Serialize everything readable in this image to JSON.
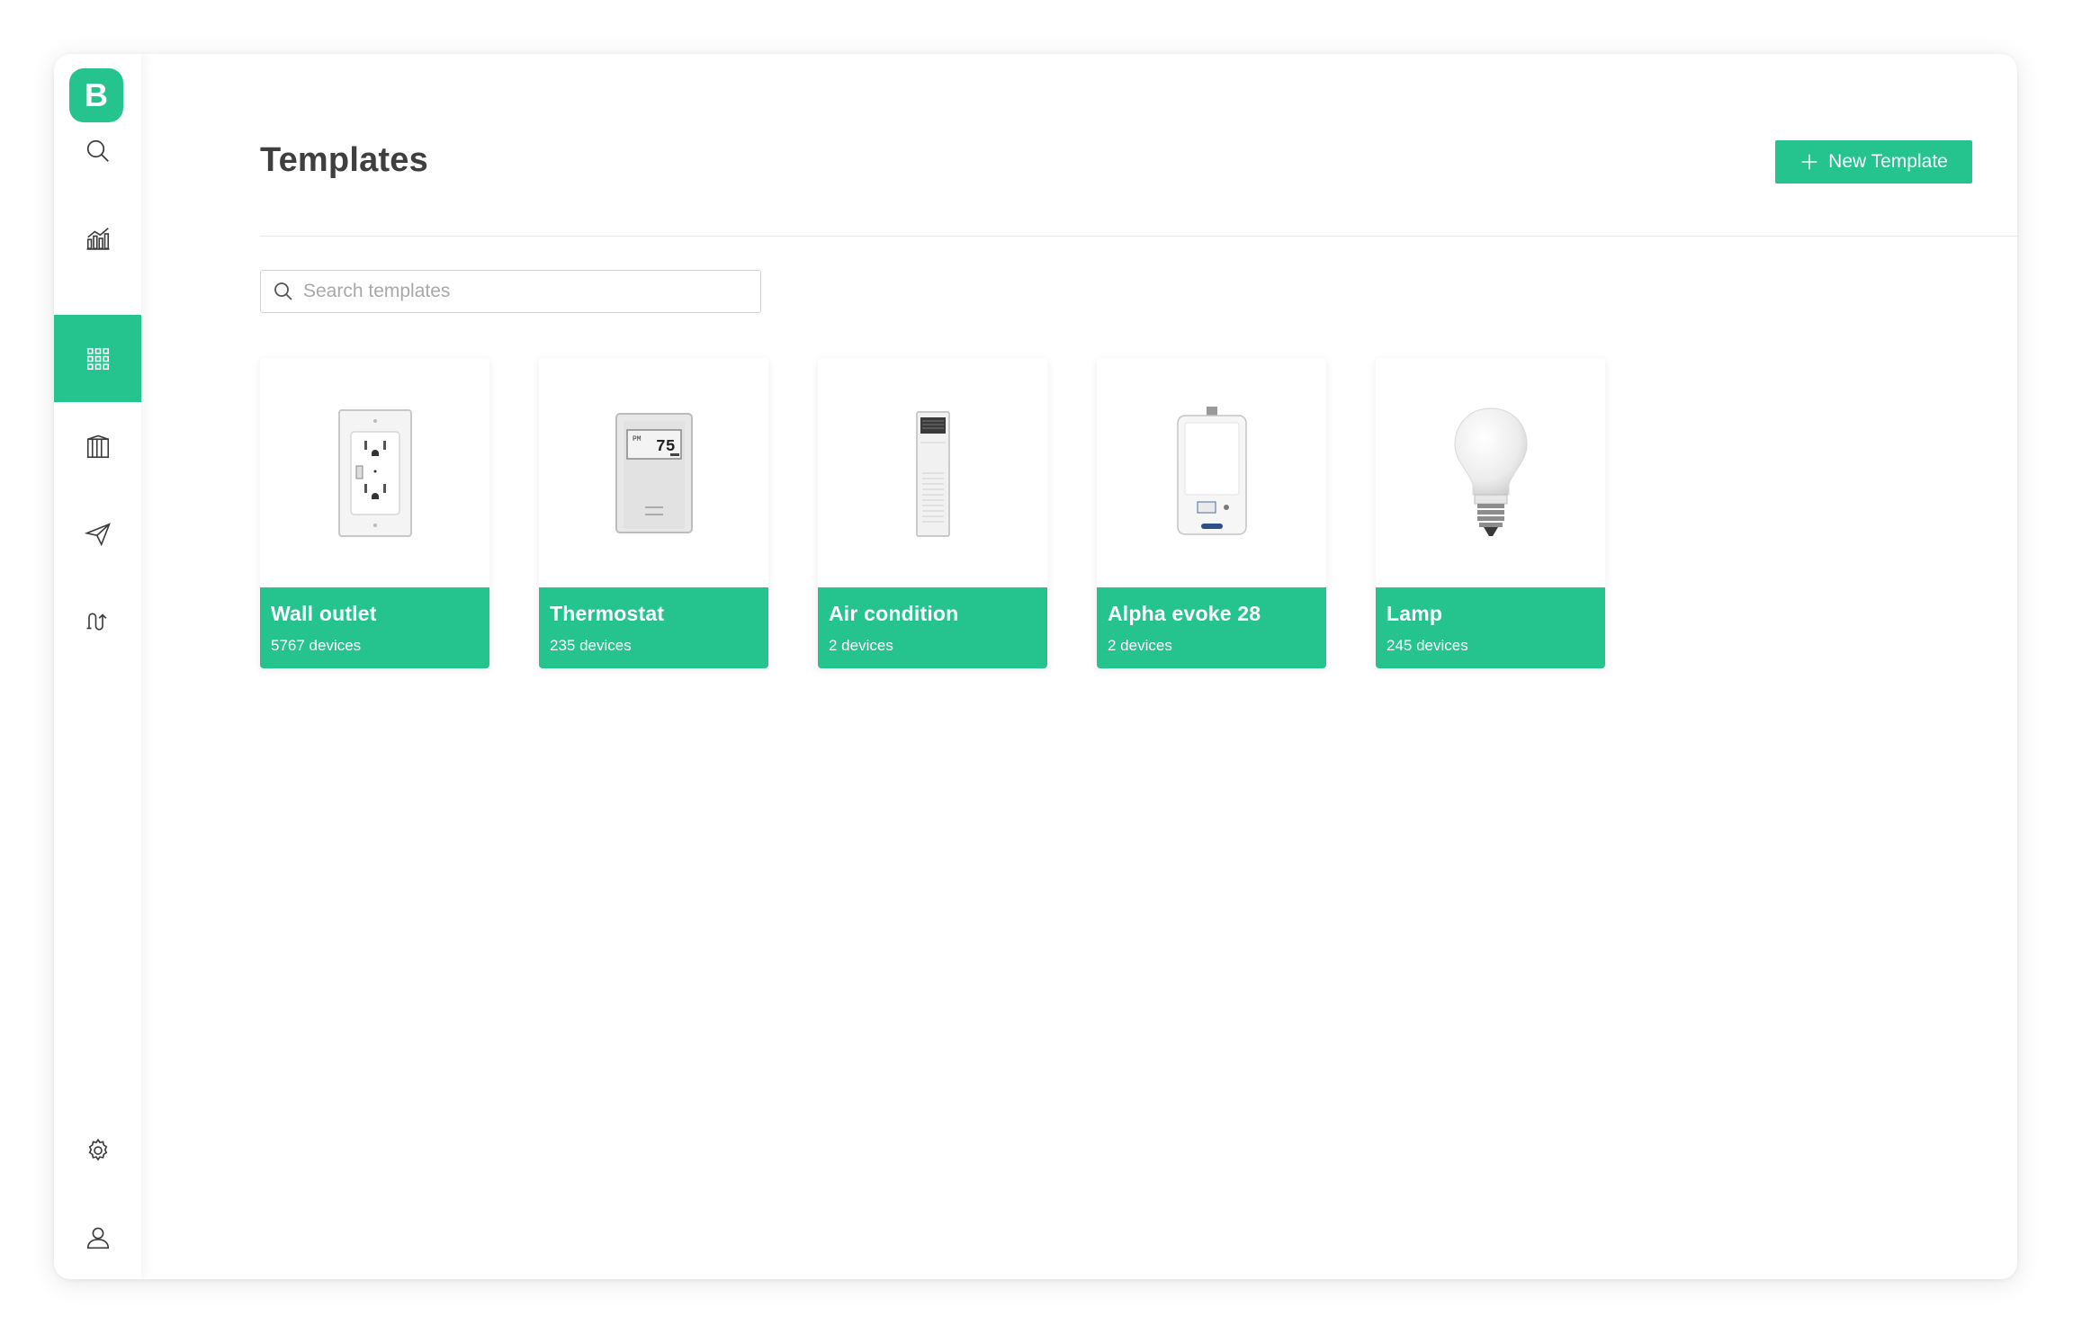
{
  "app": {
    "logo_letter": "B"
  },
  "sidebar": {
    "items": [
      {
        "icon": "search-icon"
      },
      {
        "icon": "analytics-icon"
      },
      {
        "icon": "templates-grid-icon",
        "active": true
      },
      {
        "icon": "building-icon"
      },
      {
        "icon": "send-icon"
      },
      {
        "icon": "flow-icon"
      },
      {
        "icon": "settings-gear-icon"
      },
      {
        "icon": "user-icon"
      }
    ]
  },
  "header": {
    "title": "Templates",
    "new_button_label": "New Template"
  },
  "search": {
    "placeholder": "Search templates",
    "value": ""
  },
  "templates": [
    {
      "name": "Wall outlet",
      "count": "5767 devices",
      "icon": "wall-outlet-image"
    },
    {
      "name": "Thermostat",
      "count": "235 devices",
      "icon": "thermostat-image"
    },
    {
      "name": "Air condition",
      "count": "2 devices",
      "icon": "air-condition-image"
    },
    {
      "name": "Alpha evoke 28",
      "count": "2 devices",
      "icon": "boiler-image"
    },
    {
      "name": "Lamp",
      "count": "245 devices",
      "icon": "lamp-image"
    }
  ],
  "colors": {
    "accent": "#25c38d",
    "title": "#3f3f3f",
    "divider": "#e8e8e8"
  }
}
